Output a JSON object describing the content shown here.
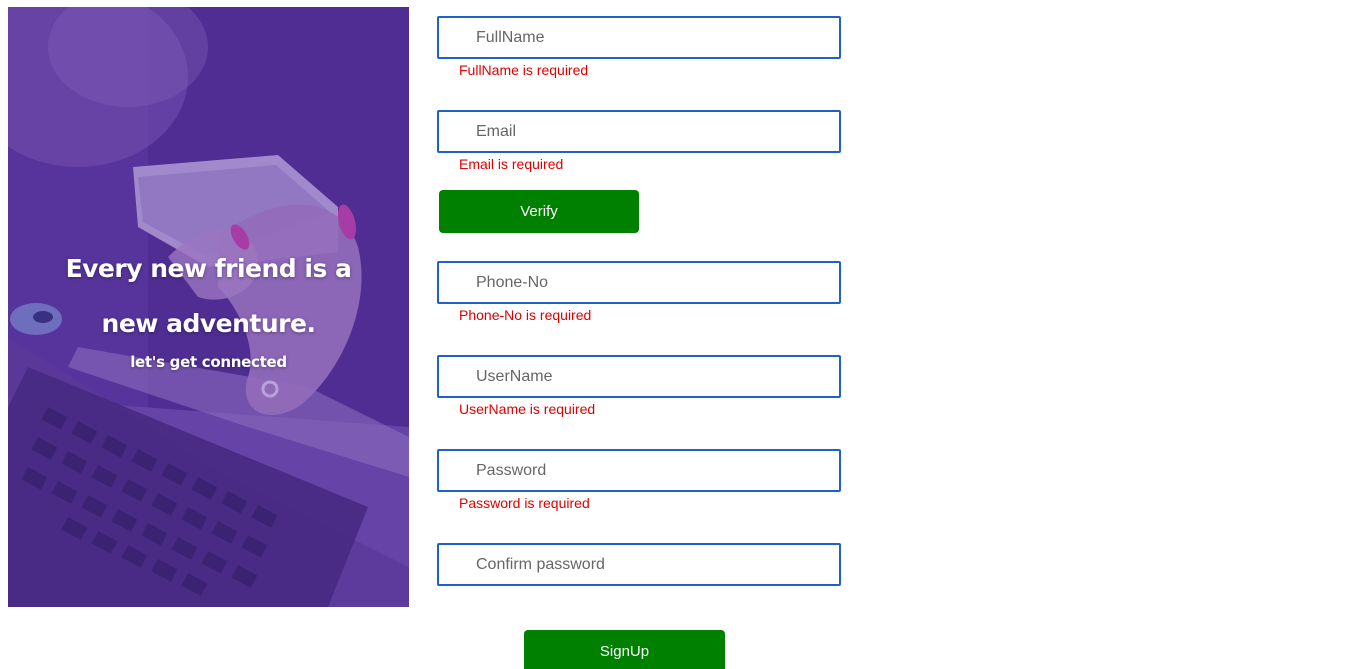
{
  "hero": {
    "headline_line1": "Every new friend is a",
    "headline_line2": "new adventure.",
    "subline": "let's get connected",
    "overlay_color": "#5a33a0"
  },
  "form": {
    "fullname": {
      "placeholder": "FullName",
      "value": "",
      "error": "FullName is required"
    },
    "email": {
      "placeholder": "Email",
      "value": "",
      "error": "Email is required"
    },
    "verify_label": "Verify",
    "phone": {
      "placeholder": "Phone-No",
      "value": "",
      "error": "Phone-No is required"
    },
    "username": {
      "placeholder": "UserName",
      "value": "",
      "error": "UserName is required"
    },
    "password": {
      "placeholder": "Password",
      "value": "",
      "error": "Password is required"
    },
    "confirm_password": {
      "placeholder": "Confirm password",
      "value": ""
    },
    "signup_label": "SignUp"
  },
  "colors": {
    "input_border": "#1e62c6",
    "error_text": "#e00000",
    "button_bg": "#008000",
    "button_text": "#ffffff"
  }
}
